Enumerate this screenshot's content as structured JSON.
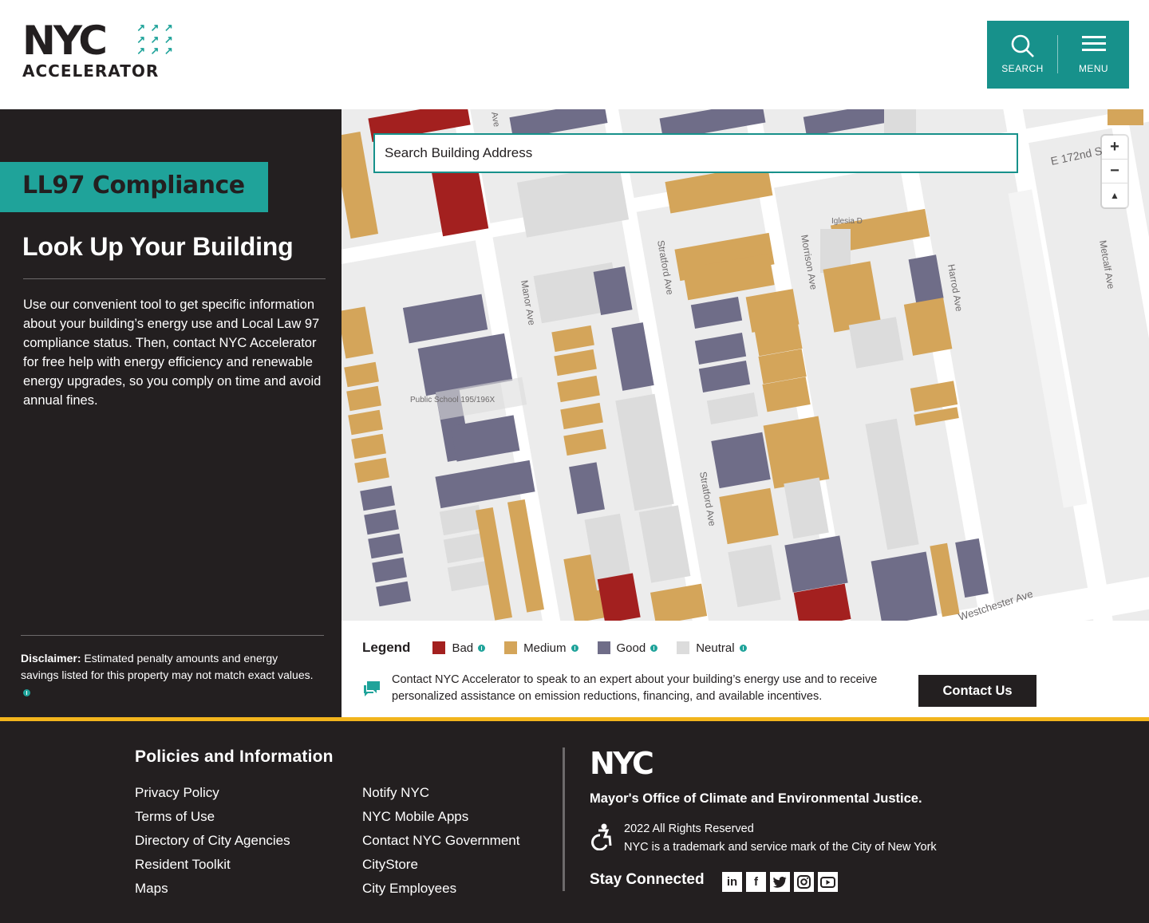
{
  "header": {
    "logo_main": "NYC",
    "logo_sub": "ACCELERATOR",
    "search_label": "SEARCH",
    "menu_label": "MENU"
  },
  "sidebar": {
    "badge": "LL97 Compliance",
    "title": "Look Up Your Building",
    "intro": "Use our convenient tool to get specific information about your building’s energy use and Local Law 97 compliance status. Then, contact NYC Accelerator for free help with energy efficiency and renewable energy upgrades, so you comply on time and avoid annual fines.",
    "disclaimer_label": "Disclaimer:",
    "disclaimer_text": " Estimated penalty amounts and energy savings listed for this property may not match exact values."
  },
  "map": {
    "search_placeholder": "Search Building Address",
    "zoom_in": "+",
    "zoom_out": "−",
    "reset_north": "▲",
    "street_labels": {
      "e172": "E 172nd S",
      "manor": "Manor Ave",
      "stratford1": "Stratford Ave",
      "stratford2": "Stratford Ave",
      "morrison": "Morrison Ave",
      "harrod": "Harrod Ave",
      "metcalf": "Metcalf Ave",
      "westchester": "Westchester Ave",
      "iglesia": "Iglesia D",
      "ps": "Public School 195/196X",
      "ave_top": "Ave"
    }
  },
  "legend": {
    "title": "Legend",
    "items": [
      {
        "label": "Bad",
        "color": "#a3201f"
      },
      {
        "label": "Medium",
        "color": "#d4a55a"
      },
      {
        "label": "Good",
        "color": "#6f6d88"
      },
      {
        "label": "Neutral",
        "color": "#dcdcdc"
      }
    ]
  },
  "contact": {
    "text": "Contact NYC Accelerator to speak to an expert about your building’s energy use and to receive personalized assistance on emission reductions, financing, and available incentives.",
    "button": "Contact Us"
  },
  "footer": {
    "heading": "Policies and Information",
    "col1": [
      "Privacy Policy",
      "Terms of Use",
      "Directory of City Agencies",
      "Resident Toolkit",
      "Maps"
    ],
    "col2": [
      "Notify NYC",
      "NYC Mobile Apps",
      "Contact NYC Government",
      "CityStore",
      "City Employees"
    ],
    "logo": "NYC",
    "mayor": "Mayor's Office of Climate and Environmental Justice.",
    "rights": "2022 All Rights Reserved",
    "trademark": "NYC is a trademark and service mark of the City of New York",
    "stay": "Stay Connected",
    "socials": [
      "linkedin-icon",
      "facebook-icon",
      "twitter-icon",
      "instagram-icon",
      "youtube-icon"
    ]
  },
  "colors": {
    "teal": "#17918b",
    "dark": "#231f20",
    "yellow_rule": "#f2b51c"
  }
}
